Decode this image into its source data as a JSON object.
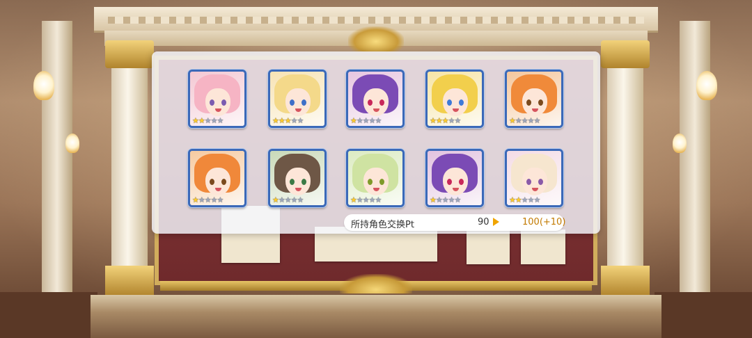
{
  "cards": [
    {
      "id": "c1",
      "stars": 2,
      "max_stars": 5,
      "hair": "#f6b4c4",
      "bg": "#f3c8d3",
      "eye": "#7b5bb0"
    },
    {
      "id": "c2",
      "stars": 3,
      "max_stars": 5,
      "hair": "#f4d98a",
      "bg": "#f7e3b4",
      "eye": "#3f6fc8"
    },
    {
      "id": "c3",
      "stars": 1,
      "max_stars": 5,
      "hair": "#7b4bb5",
      "bg": "#e7c6e0",
      "eye": "#c8285a"
    },
    {
      "id": "c4",
      "stars": 3,
      "max_stars": 5,
      "hair": "#f2cf4c",
      "bg": "#f6e4a6",
      "eye": "#3e7ad8"
    },
    {
      "id": "c5",
      "stars": 1,
      "max_stars": 5,
      "hair": "#f08a3a",
      "bg": "#f5c79d",
      "eye": "#7b4a1e"
    },
    {
      "id": "c6",
      "stars": 1,
      "max_stars": 5,
      "hair": "#f0883a",
      "bg": "#f6caa0",
      "eye": "#7b4a1e"
    },
    {
      "id": "c7",
      "stars": 1,
      "max_stars": 5,
      "hair": "#6e5746",
      "bg": "#c9d9b8",
      "eye": "#3c7a46"
    },
    {
      "id": "c8",
      "stars": 1,
      "max_stars": 5,
      "hair": "#cfe3a2",
      "bg": "#dcebc2",
      "eye": "#7f9a2a"
    },
    {
      "id": "c9",
      "stars": 1,
      "max_stars": 5,
      "hair": "#7b4bb5",
      "bg": "#e2c3df",
      "eye": "#c8285a"
    },
    {
      "id": "c10",
      "stars": 2,
      "max_stars": 5,
      "hair": "#f6e6cf",
      "bg": "#f4dce6",
      "eye": "#8a5aa8"
    }
  ],
  "pt": {
    "label": "所持角色交换Pt",
    "current": "90",
    "new_value": "100(+10)"
  },
  "colors": {
    "star_on": "#ffcc2e",
    "star_off": "#8f9bb3",
    "frame": "#3b69b8",
    "accent": "#f0a400"
  },
  "icons": {
    "star": "star-icon",
    "arrow": "arrow-right-icon"
  }
}
